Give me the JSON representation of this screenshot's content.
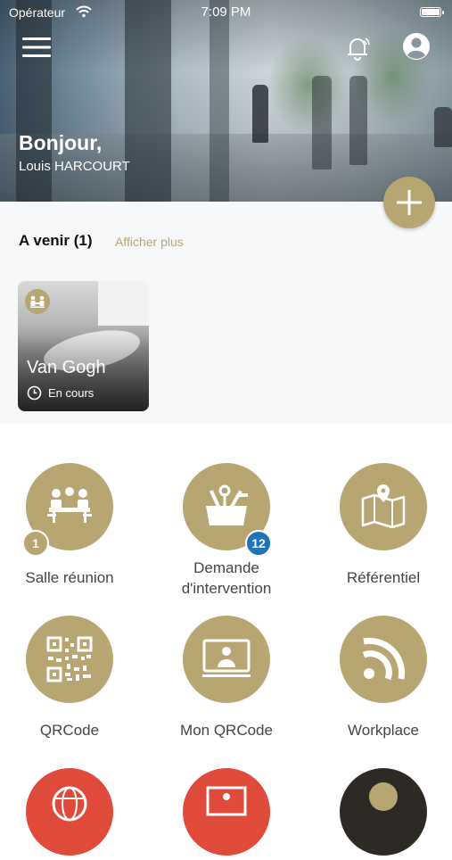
{
  "status_bar": {
    "carrier": "Opérateur",
    "time": "7:09 PM"
  },
  "header": {
    "greeting": "Bonjour,",
    "user_name": "Louis HARCOURT"
  },
  "upcoming": {
    "title": "A venir (1)",
    "more_link": "Afficher plus",
    "cards": [
      {
        "room": "Van Gogh",
        "status": "En cours"
      }
    ]
  },
  "tiles": [
    {
      "label": "Salle réunion",
      "badge": "1",
      "badge_color": "#b8a672",
      "icon": "meeting-room-icon"
    },
    {
      "label": "Demande d'intervention",
      "badge": "12",
      "badge_color": "#1f73b7",
      "icon": "toolbox-icon"
    },
    {
      "label": "Référentiel",
      "icon": "map-pin-icon"
    },
    {
      "label": "QRCode",
      "icon": "qrcode-icon"
    },
    {
      "label": "Mon QRCode",
      "icon": "presentation-icon"
    },
    {
      "label": "Workplace",
      "icon": "rss-icon"
    }
  ],
  "colors": {
    "accent": "#b8a672",
    "badge_blue": "#1f73b7",
    "red": "#e04a3a"
  }
}
